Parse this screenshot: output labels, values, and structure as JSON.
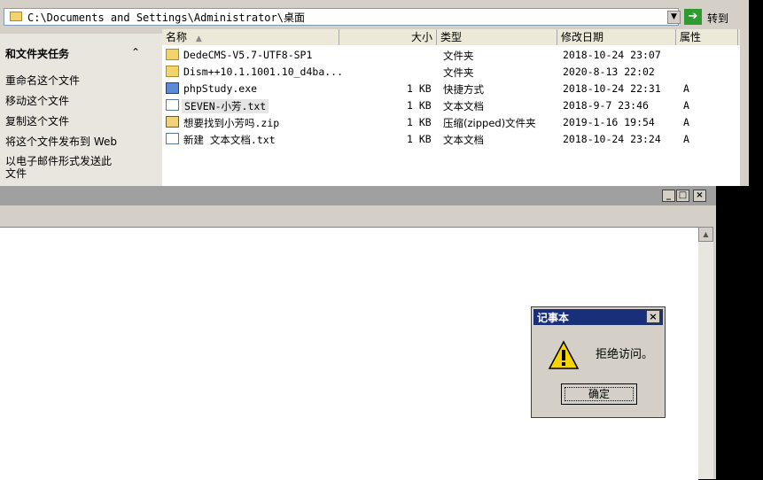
{
  "address": {
    "path": "C:\\Documents and Settings\\Administrator\\桌面",
    "go_label": "转到"
  },
  "tasks": {
    "title": "和文件夹任务",
    "items": [
      "重命名这个文件",
      "移动这个文件",
      "复制这个文件",
      "将这个文件发布到 Web",
      "以电子邮件形式发送此",
      "文件"
    ]
  },
  "columns": {
    "name": "名称",
    "size": "大小",
    "type": "类型",
    "modified": "修改日期",
    "attr": "属性"
  },
  "files": [
    {
      "name": "DedeCMS-V5.7-UTF8-SP1",
      "size": "",
      "type": "文件夹",
      "modified": "2018-10-24 23:07",
      "attr": "",
      "icon": "folder-icon"
    },
    {
      "name": "Dism++10.1.1001.10_d4ba...",
      "size": "",
      "type": "文件夹",
      "modified": "2020-8-13 22:02",
      "attr": "",
      "icon": "folder-icon"
    },
    {
      "name": "phpStudy.exe",
      "size": "1 KB",
      "type": "快捷方式",
      "modified": "2018-10-24 22:31",
      "attr": "A",
      "icon": "shortcut-icon"
    },
    {
      "name": "SEVEN-小芳.txt",
      "size": "1 KB",
      "type": "文本文档",
      "modified": "2018-9-7 23:46",
      "attr": "A",
      "icon": "text-file-icon"
    },
    {
      "name": "想要找到小芳吗.zip",
      "size": "1 KB",
      "type": "压缩(zipped)文件夹",
      "modified": "2019-1-16 19:54",
      "attr": "A",
      "icon": "zip-icon"
    },
    {
      "name": "新建 文本文档.txt",
      "size": "1 KB",
      "type": "文本文档",
      "modified": "2018-10-24 23:24",
      "attr": "A",
      "icon": "text-file-icon"
    }
  ],
  "notepad": {
    "min_label": "_",
    "max_label": "□",
    "close_label": "×"
  },
  "dialog": {
    "title": "记事本",
    "message": "拒绝访问。",
    "ok_label": "确定",
    "close_label": "×"
  }
}
